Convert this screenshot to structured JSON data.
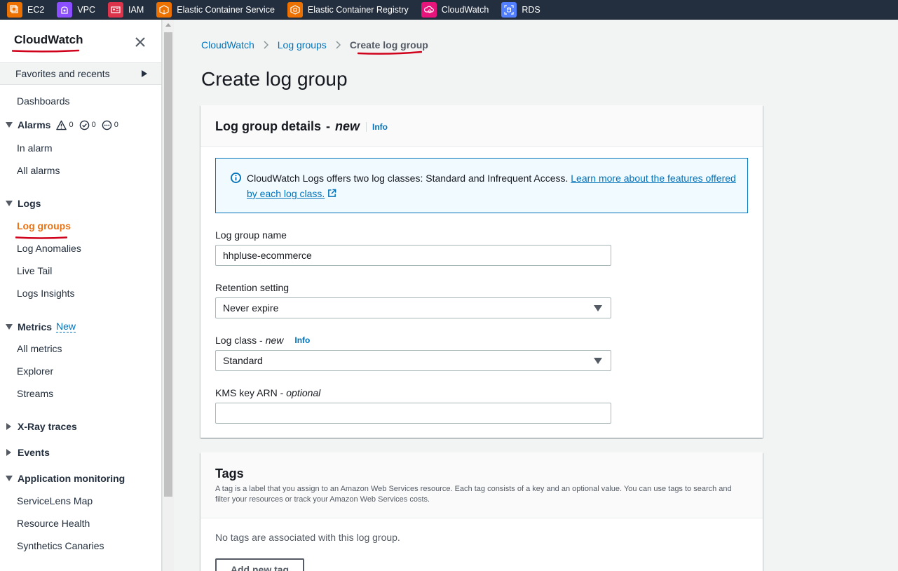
{
  "topbar": {
    "services": [
      {
        "label": "EC2",
        "icon": "ec2-icon",
        "color": "#ed7100"
      },
      {
        "label": "VPC",
        "icon": "vpc-icon",
        "color": "#8c4fff"
      },
      {
        "label": "IAM",
        "icon": "iam-icon",
        "color": "#dd344c"
      },
      {
        "label": "Elastic Container Service",
        "icon": "ecs-icon",
        "color": "#ed7100"
      },
      {
        "label": "Elastic Container Registry",
        "icon": "ecr-icon",
        "color": "#ed7100"
      },
      {
        "label": "CloudWatch",
        "icon": "cloudwatch-icon",
        "color": "#e7157b"
      },
      {
        "label": "RDS",
        "icon": "rds-icon",
        "color": "#527fff"
      }
    ]
  },
  "sidebar": {
    "title": "CloudWatch",
    "favorites_label": "Favorites and recents",
    "dashboards": "Dashboards",
    "alarms": {
      "label": "Alarms",
      "in_alarm_count": "0",
      "ok_count": "0",
      "insufficient_count": "0",
      "items": [
        "In alarm",
        "All alarms"
      ]
    },
    "logs": {
      "label": "Logs",
      "items": [
        "Log groups",
        "Log Anomalies",
        "Live Tail",
        "Logs Insights"
      ],
      "active": "Log groups"
    },
    "metrics": {
      "label": "Metrics",
      "new_badge": "New",
      "items": [
        "All metrics",
        "Explorer",
        "Streams"
      ]
    },
    "xray": "X-Ray traces",
    "events": "Events",
    "app_monitoring": {
      "label": "Application monitoring",
      "items": [
        "ServiceLens Map",
        "Resource Health",
        "Synthetics Canaries"
      ]
    }
  },
  "breadcrumb": {
    "items": [
      "CloudWatch",
      "Log groups"
    ],
    "current": "Create log group"
  },
  "page_title": "Create log group",
  "details": {
    "title": "Log group details",
    "title_dash": "-",
    "title_new": "new",
    "info": "Info",
    "alert_text": "CloudWatch Logs offers two log classes: Standard and Infrequent Access.",
    "alert_link": "Learn more about the features offered by each log class.",
    "name_label": "Log group name",
    "name_value": "hhpluse-ecommerce",
    "retention_label": "Retention setting",
    "retention_value": "Never expire",
    "class_label": "Log class -",
    "class_new": "new",
    "class_info": "Info",
    "class_value": "Standard",
    "kms_label": "KMS key ARN -",
    "kms_optional": "optional",
    "kms_value": ""
  },
  "tags": {
    "title": "Tags",
    "description": "A tag is a label that you assign to an Amazon Web Services resource. Each tag consists of a key and an optional value. You can use tags to search and filter your resources or track your Amazon Web Services costs.",
    "empty": "No tags are associated with this log group.",
    "add_button": "Add new tag"
  },
  "colors": {
    "link": "#0073bb",
    "active_nav": "#ec7211",
    "annotation_red": "#d0021b",
    "topbar_bg": "#232f3e"
  }
}
